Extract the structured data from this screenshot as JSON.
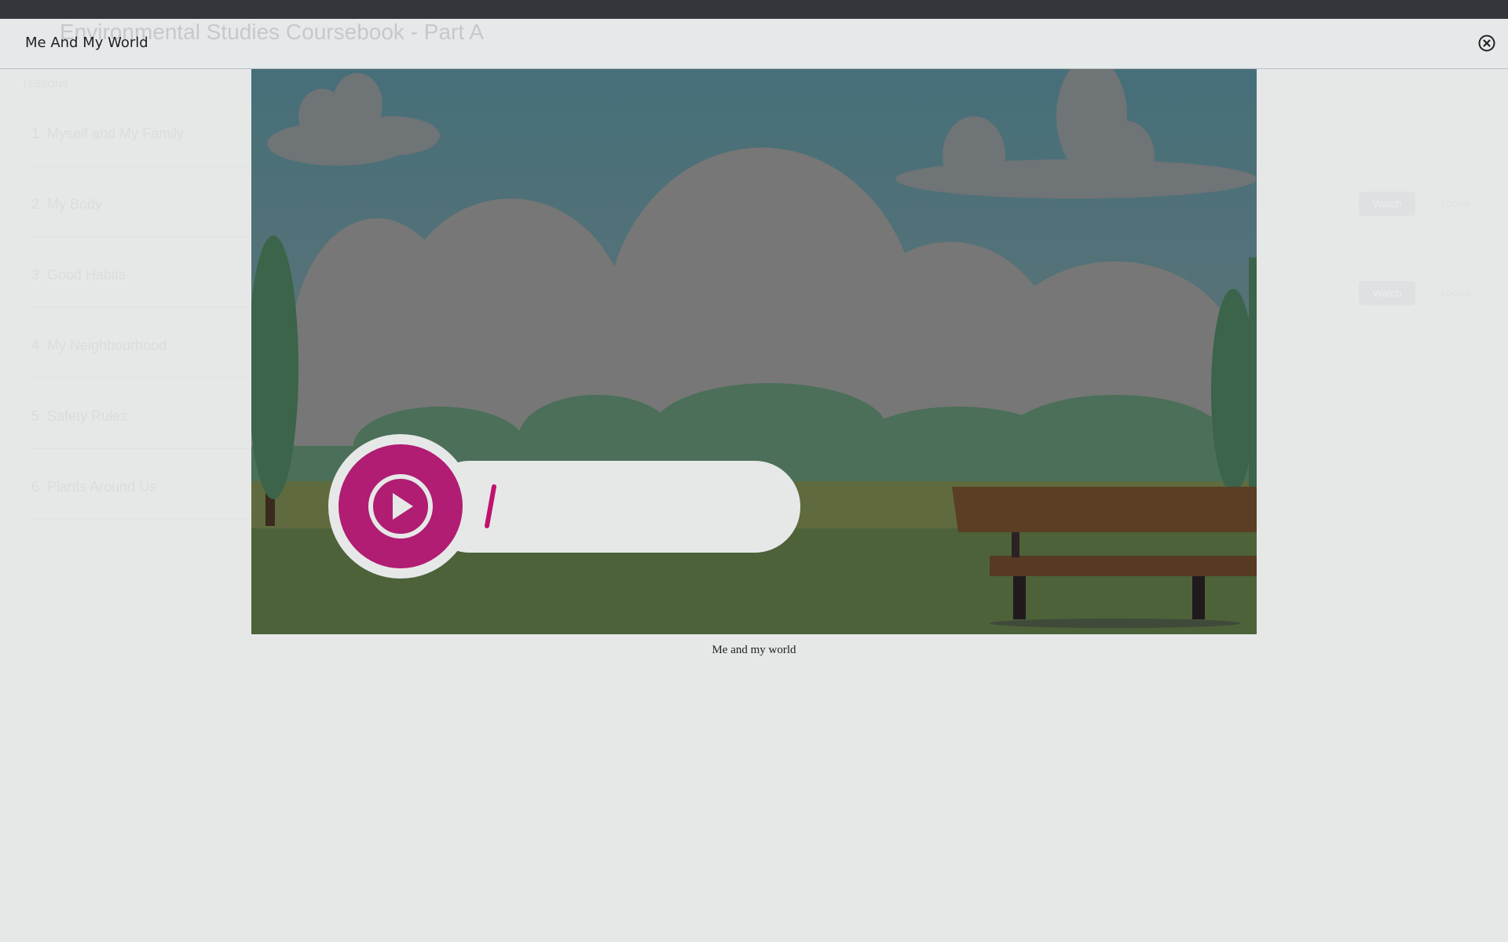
{
  "background_page": {
    "title": "Environmental Studies Coursebook - Part A",
    "lessons_label": "LESSONS",
    "lessons": [
      {
        "number": "1",
        "label": "Myself and My Family"
      },
      {
        "number": "2",
        "label": "My Body"
      },
      {
        "number": "3",
        "label": "Good Habits"
      },
      {
        "number": "4",
        "label": "My Neighbourhood"
      },
      {
        "number": "5",
        "label": "Safety Rules"
      },
      {
        "number": "6",
        "label": "Plants Around Us"
      }
    ],
    "actions": [
      {
        "watch": "Watch",
        "locate": "Locate"
      },
      {
        "watch": "Watch",
        "locate": "Locate"
      }
    ]
  },
  "modal": {
    "title": "Me And My World",
    "close_icon": "close-circle-icon",
    "video": {
      "play_icon": "play-icon"
    },
    "caption": "Me and my world"
  },
  "colors": {
    "accent": "#b01d72",
    "sky": "#4a7078",
    "grass": "#4e6239"
  }
}
